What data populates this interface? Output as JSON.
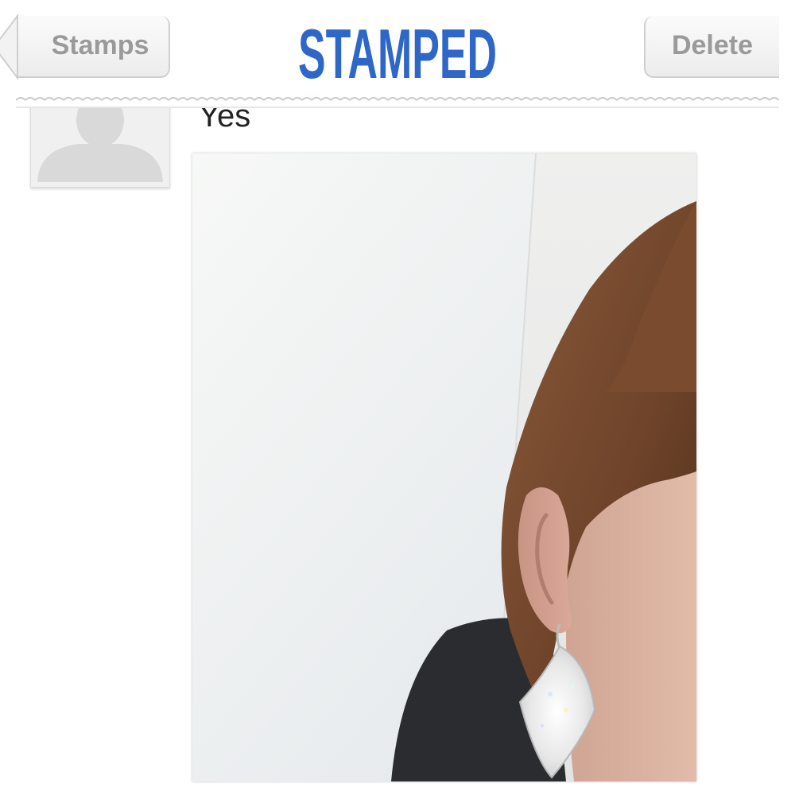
{
  "navbar": {
    "back_label": "Stamps",
    "title": "STAMPED",
    "delete_label": "Delete",
    "title_color": "#2e67c8"
  },
  "comment": {
    "text": "Yes"
  }
}
